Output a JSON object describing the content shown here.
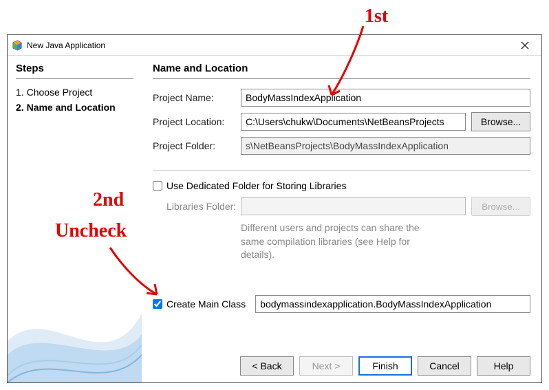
{
  "titlebar": {
    "title": "New Java Application"
  },
  "left": {
    "heading": "Steps",
    "steps": [
      "Choose Project",
      "Name and Location"
    ],
    "current_step": 1
  },
  "right": {
    "heading": "Name and Location",
    "project_name_label": "Project Name:",
    "project_name_value": "BodyMassIndexApplication",
    "project_location_label": "Project Location:",
    "project_location_value": "C:\\Users\\chukw\\Documents\\NetBeansProjects",
    "browse_label": "Browse...",
    "project_folder_label": "Project Folder:",
    "project_folder_value": "s\\NetBeansProjects\\BodyMassIndexApplication",
    "dedicated_folder_label": "Use Dedicated Folder for Storing Libraries",
    "dedicated_folder_checked": false,
    "libraries_folder_label": "Libraries Folder:",
    "libraries_folder_value": "",
    "libraries_help": "Different users and projects can share the same compilation libraries (see Help for details).",
    "create_main_label": "Create Main Class",
    "create_main_checked": true,
    "main_class_value": "bodymassindexapplication.BodyMassIndexApplication"
  },
  "buttons": {
    "back": "< Back",
    "next": "Next >",
    "finish": "Finish",
    "cancel": "Cancel",
    "help": "Help"
  },
  "annotations": {
    "first": "1st",
    "second": "2nd",
    "uncheck": "Uncheck"
  }
}
